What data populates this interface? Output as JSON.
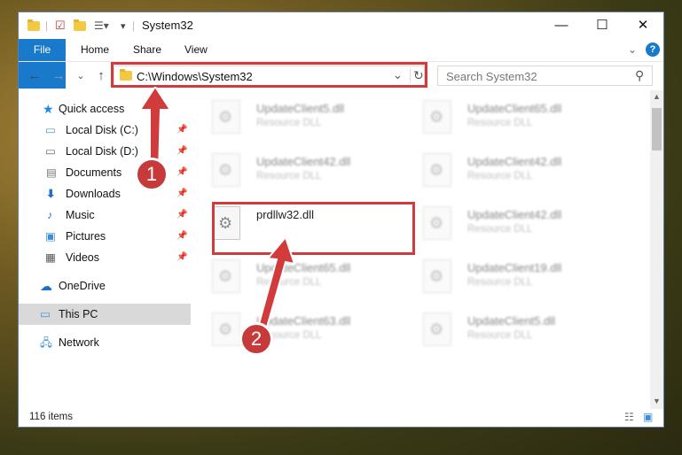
{
  "window": {
    "title": "System32",
    "controls": {
      "minimize": "—",
      "maximize": "☐",
      "close": "✕"
    }
  },
  "ribbon": {
    "tabs": [
      "File",
      "Home",
      "Share",
      "View"
    ],
    "expand_glyph": "⌄",
    "help_glyph": "?"
  },
  "address": {
    "path": "C:\\Windows\\System32",
    "search_placeholder": "Search System32",
    "dropdown_glyph": "⌄",
    "refresh_glyph": "↻",
    "search_glyph": "⚲"
  },
  "nav": {
    "back_glyph": "←",
    "forward_glyph": "→",
    "recent_glyph": "⌄",
    "up_glyph": "↑",
    "items": [
      {
        "label": "Quick access",
        "pinned": false
      },
      {
        "label": "Local Disk (C:)",
        "pinned": true
      },
      {
        "label": "Local Disk (D:)",
        "pinned": true
      },
      {
        "label": "Documents",
        "pinned": true
      },
      {
        "label": "Downloads",
        "pinned": true
      },
      {
        "label": "Music",
        "pinned": true
      },
      {
        "label": "Pictures",
        "pinned": true
      },
      {
        "label": "Videos",
        "pinned": true
      },
      {
        "label": "OneDrive",
        "pinned": false
      },
      {
        "label": "This PC",
        "pinned": false,
        "selected": true
      },
      {
        "label": "Network",
        "pinned": false
      }
    ],
    "pin_glyph": "📌"
  },
  "files": [
    {
      "name": "UpdateClient5.dll",
      "type": "Resource DLL"
    },
    {
      "name": "UpdateClient65.dll",
      "type": "Resource DLL"
    },
    {
      "name": "UpdateClient42.dll",
      "type": "Resource DLL"
    },
    {
      "name": "UpdateClient42.dll",
      "type": "Resource DLL"
    },
    {
      "name": "prdllw32.dll",
      "type": ""
    },
    {
      "name": "UpdateClient42.dll",
      "type": "Resource DLL"
    },
    {
      "name": "UpdateClient65.dll",
      "type": "Resource DLL"
    },
    {
      "name": "UpdateClient19.dll",
      "type": "Resource DLL"
    },
    {
      "name": "UpdateClient63.dll",
      "type": "Resource DLL"
    },
    {
      "name": "UpdateClient5.dll",
      "type": "Resource DLL"
    }
  ],
  "status": {
    "item_count": "116 items"
  },
  "annotations": {
    "step1": "1",
    "step2": "2",
    "color": "#d13b3b"
  }
}
